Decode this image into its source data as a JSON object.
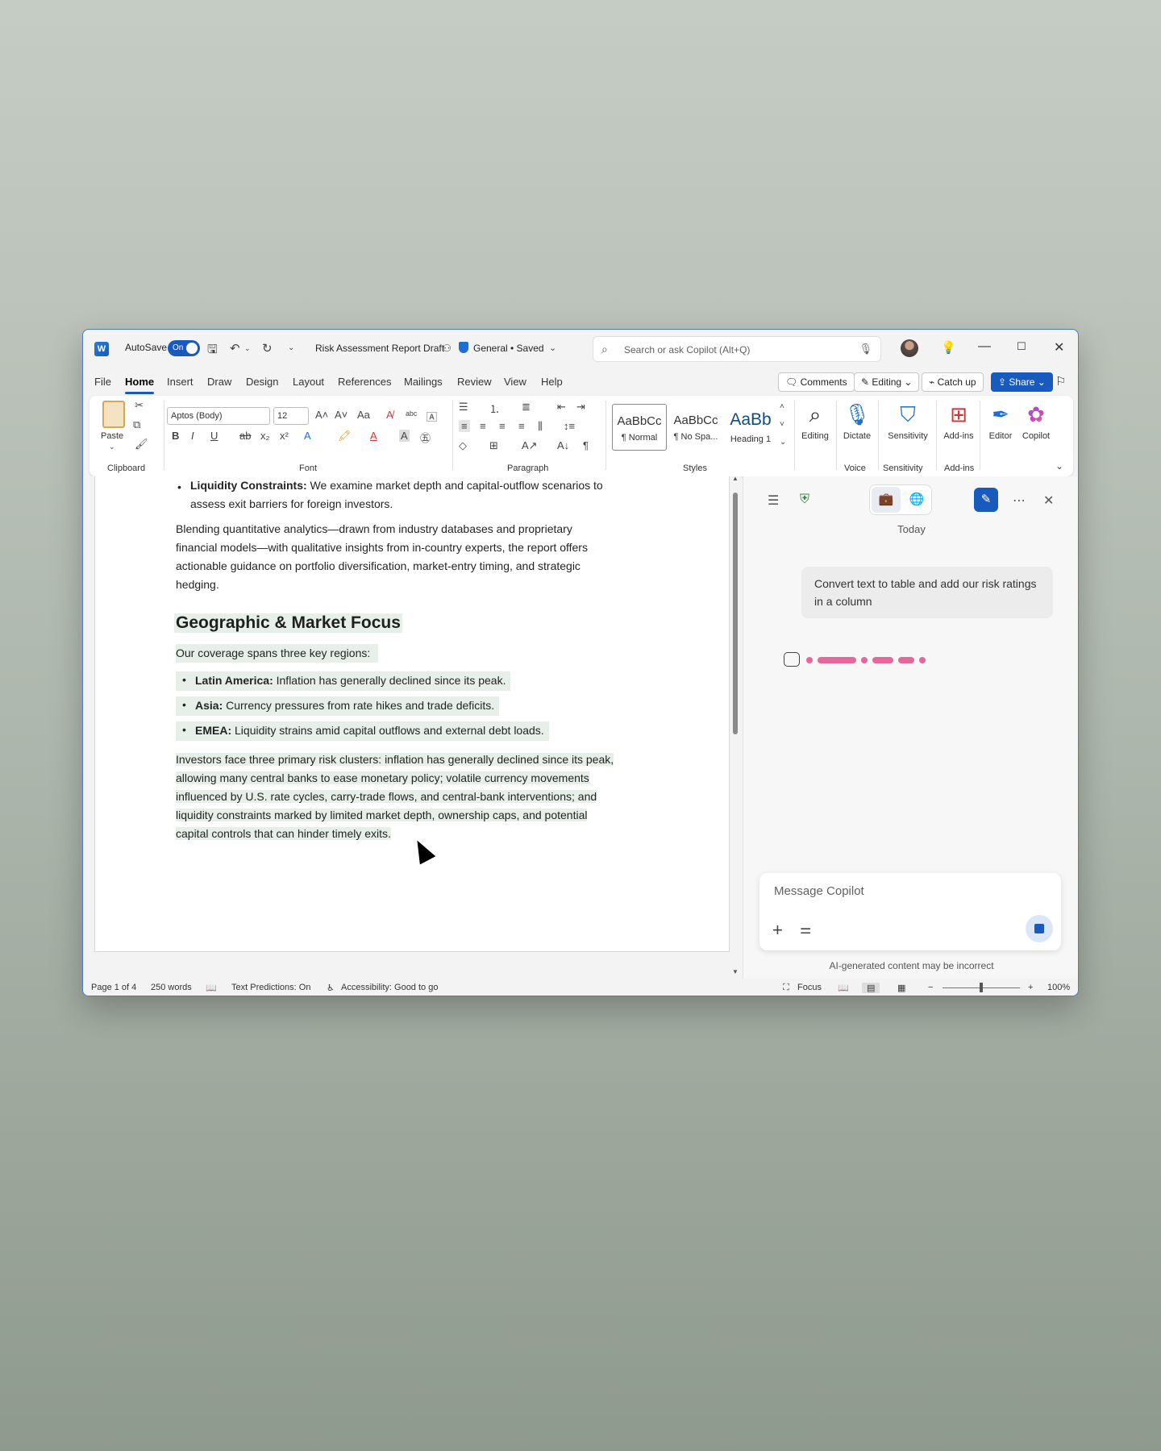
{
  "titlebar": {
    "autosave_label": "AutoSave",
    "autosave_state": "On",
    "doc_title": "Risk Assessment Report Draft",
    "sensitivity": "General",
    "saved_state": "• Saved",
    "search_placeholder": "Search or ask Copilot (Alt+Q)"
  },
  "menu": {
    "tabs": [
      "File",
      "Home",
      "Insert",
      "Draw",
      "Design",
      "Layout",
      "References",
      "Mailings",
      "Review",
      "View",
      "Help"
    ],
    "active_tab": "Home",
    "comments_label": "Comments",
    "editing_label": "Editing",
    "catchup_label": "Catch up",
    "share_label": "Share"
  },
  "ribbon": {
    "paste_label": "Paste",
    "font_name": "Aptos (Body)",
    "font_size": "12",
    "groups": {
      "clipboard": "Clipboard",
      "font": "Font",
      "paragraph": "Paragraph",
      "styles": "Styles",
      "voice": "Voice",
      "sensitivity": "Sensitivity",
      "addins": "Add-ins"
    },
    "styles": [
      {
        "sample": "AaBbCc",
        "name": "¶ Normal"
      },
      {
        "sample": "AaBbCc",
        "name": "¶ No Spa..."
      },
      {
        "sample": "AaBb",
        "name": "Heading 1"
      }
    ],
    "buttons": {
      "editing": "Editing",
      "dictate": "Dictate",
      "sensitivity": "Sensitivity",
      "addins": "Add-ins",
      "editor": "Editor",
      "copilot": "Copilot"
    },
    "accent_color": "#185abd"
  },
  "document": {
    "bullet_liquidity_bold": "Liquidity Constraints:",
    "bullet_liquidity_line1": " We examine market depth and capital-outflow scenarios to",
    "bullet_liquidity_line2": "assess exit barriers for foreign investors.",
    "para1": [
      "Blending quantitative analytics—drawn from industry databases and proprietary",
      "financial models—with qualitative insights from in-country experts, the report offers",
      "actionable guidance on portfolio diversification, market-entry timing, and strategic",
      "hedging."
    ],
    "heading": "Geographic & Market Focus",
    "coverage": "Our coverage spans three key regions:",
    "regions": [
      {
        "bold": "Latin America:",
        "text": " Inflation has generally declined since its peak."
      },
      {
        "bold": "Asia:",
        "text": " Currency pressures from rate hikes and trade deficits."
      },
      {
        "bold": "EMEA:",
        "text": " Liquidity strains amid capital outflows and external debt loads."
      }
    ],
    "para2": [
      "Investors face three primary risk clusters: inflation has generally declined since its peak,",
      "allowing many central banks to ease monetary policy; volatile currency movements",
      "influenced by U.S. rate cycles, carry-trade flows, and central-bank interventions; and",
      "liquidity constraints marked by limited market depth, ownership caps, and potential",
      "capital controls that can hinder timely exits."
    ]
  },
  "copilot": {
    "today_label": "Today",
    "user_message": "Convert text to table and add our risk ratings in a column",
    "input_placeholder": "Message Copilot",
    "disclaimer": "AI-generated content may be incorrect"
  },
  "statusbar": {
    "page": "Page 1 of 4",
    "words": "250 words",
    "text_predictions": "Text Predictions: On",
    "accessibility": "Accessibility: Good to go",
    "focus": "Focus",
    "zoom": "100%"
  }
}
